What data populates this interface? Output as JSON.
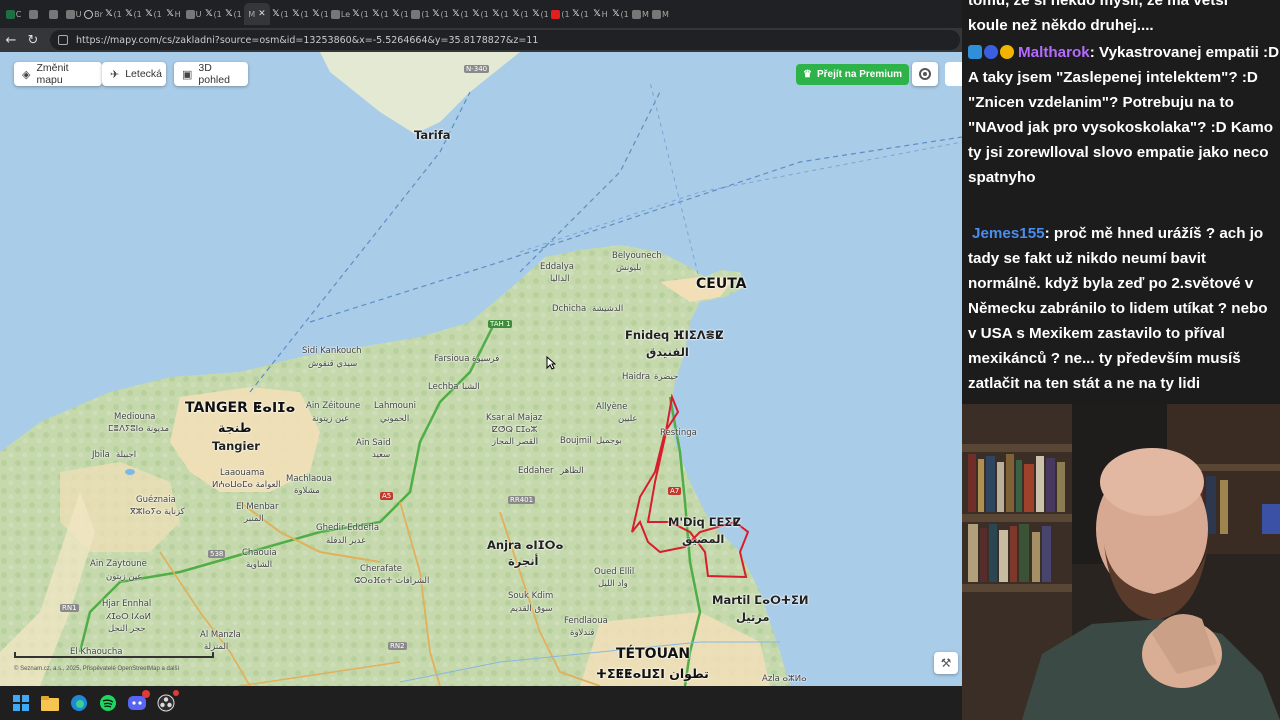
{
  "browser": {
    "active_tab_label": "M",
    "url": "https://mapy.com/cs/zakladni?source=osm&id=13253860&x=-5.5264664&y=35.8178827&z=11",
    "tabs": [
      {
        "icon": "excel-icon",
        "label": "C"
      },
      {
        "icon": "tab-icon",
        "label": ""
      },
      {
        "icon": "play-icon",
        "label": ""
      },
      {
        "icon": "tab-icon",
        "label": "U"
      },
      {
        "icon": "globe-icon",
        "label": "Br"
      },
      {
        "icon": "x-icon",
        "label": "(1"
      },
      {
        "icon": "x-icon",
        "label": "(1"
      },
      {
        "icon": "x-icon",
        "label": "(1"
      },
      {
        "icon": "x-icon",
        "label": "H"
      },
      {
        "icon": "tab-icon",
        "label": "U"
      },
      {
        "icon": "x-icon",
        "label": "(1"
      },
      {
        "icon": "x-icon",
        "label": "(1"
      },
      {
        "icon": "x-icon",
        "label": "(1"
      },
      {
        "icon": "x-icon",
        "label": "(1"
      },
      {
        "icon": "x-icon",
        "label": "(1"
      },
      {
        "icon": "tab-icon",
        "label": "Le"
      },
      {
        "icon": "x-icon",
        "label": "(1"
      },
      {
        "icon": "x-icon",
        "label": "(1"
      },
      {
        "icon": "x-icon",
        "label": "(1"
      },
      {
        "icon": "tab-icon",
        "label": "(1"
      },
      {
        "icon": "x-icon",
        "label": "(1"
      },
      {
        "icon": "x-icon",
        "label": "(1"
      },
      {
        "icon": "x-icon",
        "label": "(1"
      },
      {
        "icon": "x-icon",
        "label": "(1"
      },
      {
        "icon": "x-icon",
        "label": "(1"
      },
      {
        "icon": "x-icon",
        "label": "(1"
      },
      {
        "icon": "youtube-icon",
        "label": "(1"
      },
      {
        "icon": "x-icon",
        "label": "(1"
      },
      {
        "icon": "x-icon",
        "label": "H"
      },
      {
        "icon": "x-icon",
        "label": "(1"
      },
      {
        "icon": "search-icon",
        "label": "M"
      },
      {
        "icon": "tiktok-icon",
        "label": "M"
      }
    ]
  },
  "map": {
    "buttons": {
      "change_map": "Změnit mapu",
      "aerial": "Letecká",
      "view_3d": "3D pohled",
      "premium": "Přejít na Premium"
    },
    "copyright": "© Seznam.cz, a.s., 2025, Přispěvatelé OpenStreetMap a další",
    "labels": {
      "tarifa": "Tarifa",
      "ceuta": "CEUTA",
      "tanger": "TANGER ⵟⴰⵏⵊⴰ",
      "tanger_ar": "طنجة",
      "tangier": "Tangier",
      "fnideq": "Fnideq ⴼⵏⵉⴷⴻⵇ",
      "fnideq_ar": "الفنيدق",
      "mdiq": "M'Diq ⵎⴹⵉⵇ",
      "mdiq_ar": "المضيق",
      "anjra": "Anjra ⴰⵏⵊⵔⴰ",
      "anjra_ar": "أنجرة",
      "martil": "Martil ⵎⴰⵔⵜⵉⵍ",
      "martil_ar": "مرتيل",
      "tetouan": "TÉTOUAN",
      "tetouan_ar": "ⵜⵉⵟⵟⴰⵡⵉⵏ تطوان",
      "eddalya": "Eddalya",
      "eddalya_ar": "الداليا",
      "belyounech": "Belyounech",
      "belyounech_ar": "بليونش",
      "dchicha": "Dchicha",
      "dchicha_ar": "الدشيشة",
      "sidi_kankouch": "Sidi Kankouch",
      "sidi_kankouch_ar": "سيدي قنقوش",
      "farsioua": "Farsioua",
      "farsioua_ar": "فرسيوة",
      "lechba": "Lechba",
      "lechba_ar": "الشبا",
      "haidra": "Haidra",
      "haidra_ar": "حيضرة",
      "allyene": "Allyène",
      "allyene_ar": "عليين",
      "restinga": "Restinga",
      "mediouna": "Mediouna",
      "mediouna_ar": "ⵎⴻⴷⵢⵓⵏⴰ مديونة",
      "ain_zeitoune": "Ain Zéitoune",
      "ain_zeitoune_ar": "عين زيتونة",
      "lahmouni": "Lahmouni",
      "lahmouni_ar": "الحموني",
      "ksar_al_majaz": "Ksar al Majaz",
      "ksar_al_majaz_ar": "ⵇⵚⵕ ⵎⵊⴰⵣ",
      "ksar_al_majaz_ar2": "القصر المجاز",
      "ain_said": "Ain Said",
      "ain_said_ar": "سعيد",
      "boujmil": "Boujmil",
      "boujmil_ar": "بوجميل",
      "jbila": "Jbila",
      "jbila_ar": "اجبيلة",
      "laaouama": "Laaouama",
      "laaouama_ar": "ⵍⵄⴰⵡⴰⵎⴰ العوامة",
      "machlaoua": "Machlaoua",
      "machlaoua_ar": "مشلاوة",
      "eddaher": "Eddaher",
      "eddaher_ar": "الظاهر",
      "gueznaia": "Guéznaia",
      "gueznaia_ar": "ⴳⵣⵏⴰⵢⴰ كزناية",
      "el_menbar": "El Menbar",
      "el_menbar_ar": "المنبر",
      "ghedir_eddefla": "Ghedir Eddefla",
      "ghedir_eddefla_ar": "غدير الدفلة",
      "chaouia": "Chaouia",
      "chaouia_ar": "الشاوية",
      "cherafate": "Cherafate",
      "cherafate_ar": "ⵛⵔⴰⴼⴰⵜ الشرافات",
      "ain_zaytoune": "Ain Zaytoune",
      "ain_zaytoune_ar": "عين زيتون",
      "hjar_ennhal": "Hjar Ennhal",
      "hjar_ennhal_ar": "ⵃⵊⴰⵔ ⵏⵃⴰⵍ",
      "hjar_ennhal_ar2": "حجر النحل",
      "souk_kdim": "Souk Kdim",
      "souk_kdim_ar": "سوق القديم",
      "oued_ellil": "Oued Ellil",
      "oued_ellil_ar": "واد الليل",
      "fendlaoua": "Fendlaoua",
      "fendlaoua_ar": "فندلاوة",
      "al_manzla": "Al Manzla",
      "al_manzla_ar": "المنزلة",
      "el_khaoucha": "El Khaoucha",
      "azla": "Azla ⴰⵣⵍⴰ"
    },
    "road_shields": {
      "n340": "N-340",
      "tah1": "TAH 1",
      "a5": "A5",
      "a7": "A7",
      "rr401": "RR401",
      "r538": "538",
      "rn1": "RN1",
      "rn2": "RN2"
    }
  },
  "chat": {
    "line0": "tomu, že si někdo myslí, že má větší",
    "line1": "koule než někdo druhej....",
    "msg1_user": "Maltharok",
    "msg1_user_color": "#b46cff",
    "msg1_text": ": Vykastrovanej empatii :D A taky jsem \"Zaslepenej intelektem\"? :D \"Znicen vzdelanim\"? Potrebuju na to \"NAvod jak pro vysokoskolaka\"? :D Kamo ty jsi zorewlloval slovo empatie jako neco spatnyho",
    "msg2_user": "Jemes155",
    "msg2_user_color": "#4a8df0",
    "msg2_text": ": proč mě hned urážíš ? ach jo tady se fakt už nikdo neumí bavit normálně. když byla zeď po 2.světové v Německu zabránilo to lidem utíkat ? nebo v USA s Mexikem zastavilo to příval mexikánců ? ne... ty především musíš zatlačit na ten stát a ne na ty lidi"
  },
  "taskbar": {
    "items": [
      "windows-start-icon",
      "file-explorer-icon",
      "edge-icon",
      "spotify-icon",
      "discord-icon",
      "obs-icon"
    ],
    "discord_badge": "99+"
  },
  "colors": {
    "sea": "#a9cce8",
    "land": "#e3e9d2",
    "forest": "#bcd3a4",
    "urban": "#f2dfb8",
    "border": "#d81e2c",
    "highway": "#4fae45",
    "premium": "#2db34a"
  }
}
